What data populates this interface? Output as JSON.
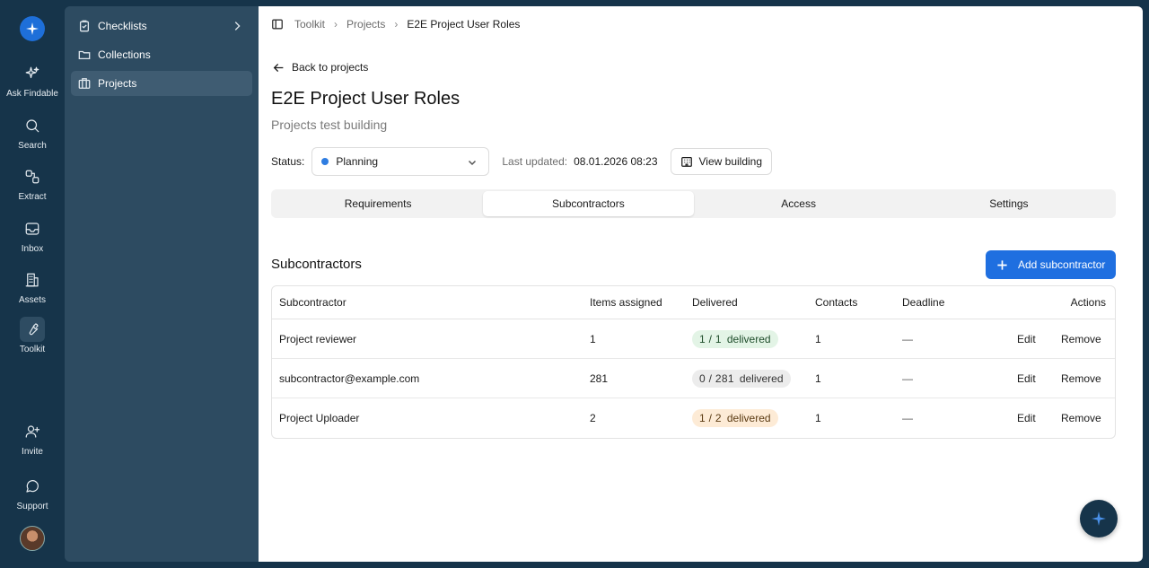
{
  "rail": {
    "items": [
      {
        "label": "Ask Findable",
        "icon": "sparkle-icon"
      },
      {
        "label": "Search",
        "icon": "search-icon"
      },
      {
        "label": "Extract",
        "icon": "extract-icon"
      },
      {
        "label": "Inbox",
        "icon": "inbox-icon"
      },
      {
        "label": "Assets",
        "icon": "building-icon"
      },
      {
        "label": "Toolkit",
        "icon": "wrench-icon"
      },
      {
        "label": "Invite",
        "icon": "user-plus-icon"
      },
      {
        "label": "Support",
        "icon": "chat-icon"
      }
    ]
  },
  "sidebar": {
    "items": [
      {
        "label": "Checklists",
        "icon": "checklist-icon"
      },
      {
        "label": "Collections",
        "icon": "folder-icon"
      },
      {
        "label": "Projects",
        "icon": "projects-icon"
      }
    ]
  },
  "breadcrumb": {
    "items": [
      "Toolkit",
      "Projects",
      "E2E Project User Roles"
    ]
  },
  "page": {
    "back_label": "Back to projects",
    "title": "E2E Project User Roles",
    "subtitle": "Projects test building",
    "status_label": "Status:",
    "status_value": "Planning",
    "status_color": "#2f7de1",
    "last_updated_label": "Last updated:",
    "last_updated_value": "08.01.2026 08:23",
    "view_building_label": "View building"
  },
  "tabs": [
    {
      "label": "Requirements",
      "active": false
    },
    {
      "label": "Subcontractors",
      "active": true
    },
    {
      "label": "Access",
      "active": false
    },
    {
      "label": "Settings",
      "active": false
    }
  ],
  "section": {
    "title": "Subcontractors",
    "add_button_label": "Add subcontractor"
  },
  "table": {
    "headers": [
      "Subcontractor",
      "Items assigned",
      "Delivered",
      "Contacts",
      "Deadline",
      "Actions"
    ],
    "rows": [
      {
        "name": "Project reviewer",
        "items": "1",
        "delivered": "1 / 1",
        "delivered_word": "delivered",
        "contacts": "1",
        "deadline": "—",
        "edit": "Edit",
        "remove": "Remove"
      },
      {
        "name": "subcontractor@example.com",
        "items": "281",
        "delivered": "0 / 281",
        "delivered_word": "delivered",
        "contacts": "1",
        "deadline": "—",
        "edit": "Edit",
        "remove": "Remove"
      },
      {
        "name": "Project Uploader",
        "items": "2",
        "delivered": "1 / 2",
        "delivered_word": "delivered",
        "contacts": "1",
        "deadline": "—",
        "edit": "Edit",
        "remove": "Remove"
      }
    ]
  }
}
